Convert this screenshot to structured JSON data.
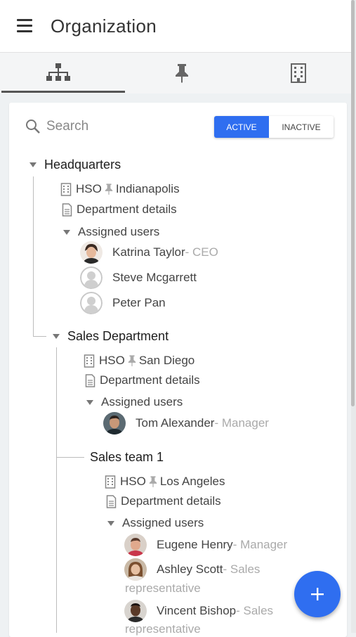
{
  "header": {
    "title": "Organization"
  },
  "tabs": [
    {
      "icon": "org-chart-icon"
    },
    {
      "icon": "pin-icon"
    },
    {
      "icon": "building-icon"
    }
  ],
  "search": {
    "placeholder": "Search"
  },
  "status_toggle": {
    "active": "ACTIVE",
    "inactive": "INACTIVE",
    "selected": "ACTIVE"
  },
  "colors": {
    "accent": "#2f6ef0",
    "role_text": "#aaaaaa"
  },
  "tree": {
    "hq": {
      "name": "Headquarters",
      "location_code": "HSO",
      "location": "Indianapolis",
      "details": "Department details",
      "assigned_label": "Assigned users",
      "users": [
        {
          "name": "Katrina Taylor",
          "role": " - CEO"
        },
        {
          "name": "Steve Mcgarrett",
          "role": ""
        },
        {
          "name": "Peter Pan",
          "role": ""
        }
      ]
    },
    "sales": {
      "name": "Sales Department",
      "location_code": "HSO",
      "location": "San Diego",
      "details": "Department details",
      "assigned_label": "Assigned users",
      "users": [
        {
          "name": "Tom Alexander",
          "role": " - Manager"
        }
      ]
    },
    "team1": {
      "name": "Sales team 1",
      "location_code": "HSO",
      "location": "Los Angeles",
      "details": "Department details",
      "assigned_label": "Assigned users",
      "users": [
        {
          "name": "Eugene Henry",
          "role": " - Manager"
        },
        {
          "name": "Ashley Scott",
          "role": " - Sales",
          "role_cont": "representative"
        },
        {
          "name": "Vincent Bishop",
          "role": " - Sales",
          "role_cont": "representative"
        }
      ]
    }
  }
}
